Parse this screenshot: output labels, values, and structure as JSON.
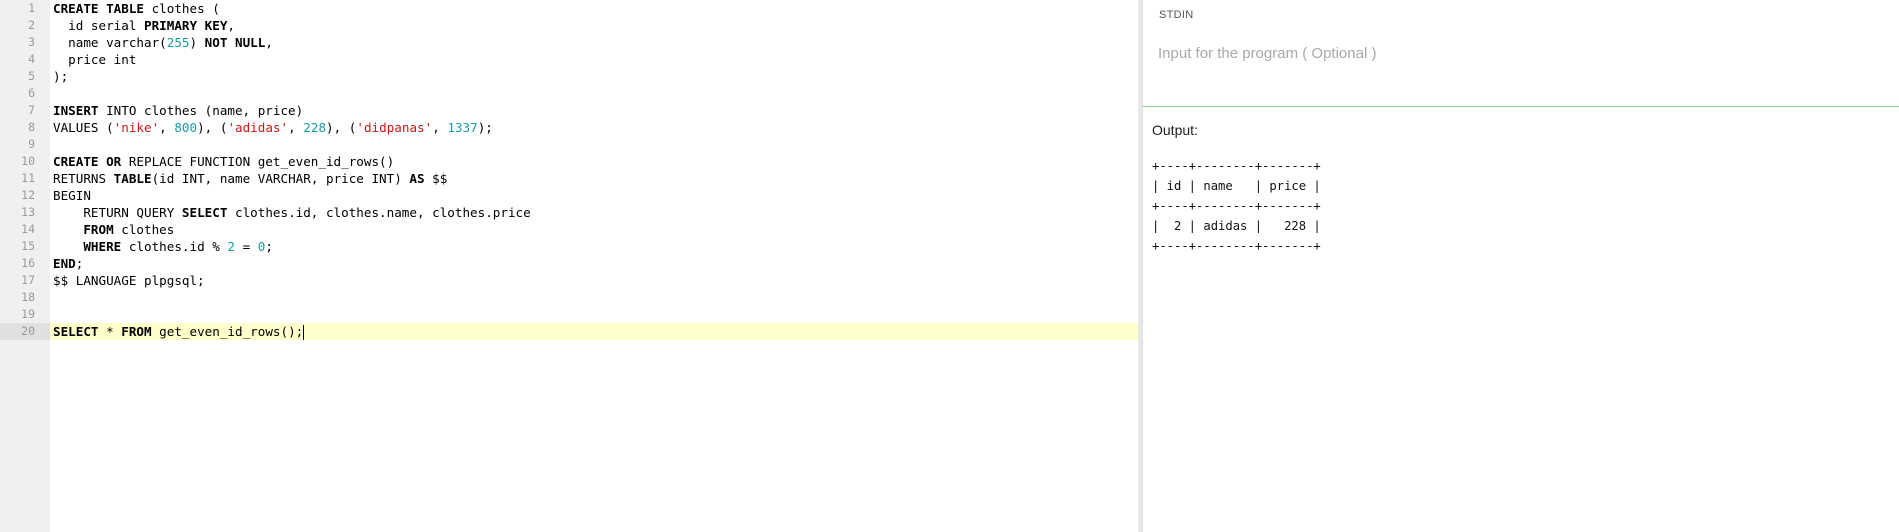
{
  "editor": {
    "line_numbers": [
      "1",
      "2",
      "3",
      "4",
      "5",
      "6",
      "7",
      "8",
      "9",
      "10",
      "11",
      "12",
      "13",
      "14",
      "15",
      "16",
      "17",
      "18",
      "19",
      "20"
    ],
    "lines": [
      [
        {
          "t": "CREATE TABLE",
          "c": "kw"
        },
        {
          "t": " clothes (",
          "c": ""
        }
      ],
      [
        {
          "t": "  id serial ",
          "c": ""
        },
        {
          "t": "PRIMARY KEY",
          "c": "kw"
        },
        {
          "t": ",",
          "c": ""
        }
      ],
      [
        {
          "t": "  name varchar(",
          "c": ""
        },
        {
          "t": "255",
          "c": "num"
        },
        {
          "t": ") ",
          "c": ""
        },
        {
          "t": "NOT NULL",
          "c": "kw"
        },
        {
          "t": ",",
          "c": ""
        }
      ],
      [
        {
          "t": "  price int",
          "c": ""
        }
      ],
      [
        {
          "t": ");",
          "c": ""
        }
      ],
      [],
      [
        {
          "t": "INSERT",
          "c": "kw"
        },
        {
          "t": " INTO clothes (name, price)",
          "c": ""
        }
      ],
      [
        {
          "t": "VALUES (",
          "c": ""
        },
        {
          "t": "'nike'",
          "c": "str"
        },
        {
          "t": ", ",
          "c": ""
        },
        {
          "t": "800",
          "c": "num"
        },
        {
          "t": "), (",
          "c": ""
        },
        {
          "t": "'adidas'",
          "c": "str"
        },
        {
          "t": ", ",
          "c": ""
        },
        {
          "t": "228",
          "c": "num"
        },
        {
          "t": "), (",
          "c": ""
        },
        {
          "t": "'didpanas'",
          "c": "str"
        },
        {
          "t": ", ",
          "c": ""
        },
        {
          "t": "1337",
          "c": "num"
        },
        {
          "t": ");",
          "c": ""
        }
      ],
      [],
      [
        {
          "t": "CREATE OR",
          "c": "kw"
        },
        {
          "t": " REPLACE FUNCTION get_even_id_rows()",
          "c": ""
        }
      ],
      [
        {
          "t": "RETURNS ",
          "c": ""
        },
        {
          "t": "TABLE",
          "c": "kw"
        },
        {
          "t": "(id INT, name VARCHAR, price INT) ",
          "c": ""
        },
        {
          "t": "AS",
          "c": "kw"
        },
        {
          "t": " $$",
          "c": ""
        }
      ],
      [
        {
          "t": "BEGIN",
          "c": ""
        }
      ],
      [
        {
          "t": "    RETURN QUERY ",
          "c": ""
        },
        {
          "t": "SELECT",
          "c": "kw"
        },
        {
          "t": " clothes.id, clothes.name, clothes.price",
          "c": ""
        }
      ],
      [
        {
          "t": "    ",
          "c": ""
        },
        {
          "t": "FROM",
          "c": "kw"
        },
        {
          "t": " clothes",
          "c": ""
        }
      ],
      [
        {
          "t": "    ",
          "c": ""
        },
        {
          "t": "WHERE",
          "c": "kw"
        },
        {
          "t": " clothes.id % ",
          "c": ""
        },
        {
          "t": "2",
          "c": "num"
        },
        {
          "t": " = ",
          "c": ""
        },
        {
          "t": "0",
          "c": "num"
        },
        {
          "t": ";",
          "c": ""
        }
      ],
      [
        {
          "t": "END",
          "c": "kw"
        },
        {
          "t": ";",
          "c": ""
        }
      ],
      [
        {
          "t": "$$ LANGUAGE plpgsql;",
          "c": ""
        }
      ],
      [],
      [],
      [
        {
          "t": "SELECT",
          "c": "kw"
        },
        {
          "t": " * ",
          "c": ""
        },
        {
          "t": "FROM",
          "c": "kw"
        },
        {
          "t": " get_even_id_rows();",
          "c": ""
        }
      ]
    ],
    "active_line": 20
  },
  "stdin": {
    "label": "STDIN",
    "placeholder": "Input for the program ( Optional )",
    "value": ""
  },
  "output": {
    "label": "Output:",
    "text": "+----+--------+-------+\n| id | name   | price |\n+----+--------+-------+\n|  2 | adidas |   228 |\n+----+--------+-------+"
  }
}
